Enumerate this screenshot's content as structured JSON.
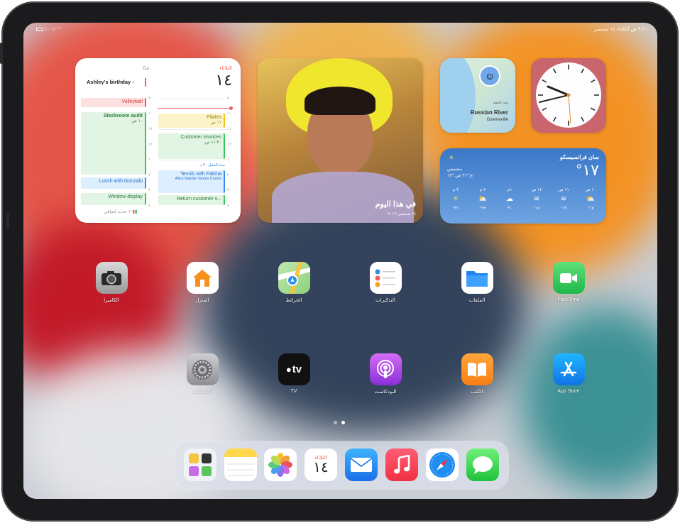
{
  "status_bar": {
    "time_date": "٩:٤١ ص الثلاثاء ١٤ سبتمبر",
    "battery": "١٠٠٪"
  },
  "calendar_widget": {
    "today_day": "الثلاثاء",
    "today_date": "١٤",
    "tomorrow_day": "غدًا",
    "all_day_event": "Ashley's birthday",
    "today_events": [
      {
        "title": "Volleyball"
      },
      {
        "title": "Stockroom audit",
        "time": "١٠ ص"
      },
      {
        "title": "Lunch with Gonzalo"
      },
      {
        "title": "Window display"
      }
    ],
    "more_events": "٢ حدث إضافي",
    "hours_left": [
      "٩",
      "١٠",
      "١١",
      "١٢",
      "١",
      "٢",
      "٣",
      "٤"
    ],
    "hours_right": [
      "٩",
      "١٠",
      "١١",
      "١٢",
      "١",
      "٢",
      "٣",
      "٤"
    ],
    "tomorrow_events": [
      {
        "title": "Pilates",
        "time": "١١ ص"
      },
      {
        "title": "Customer invoices",
        "time": "١١:٣٠ ص"
      },
      {
        "title": "Tennis with Fatima",
        "meta": "مدة التنقل ٣٠ د",
        "location": "Alice Marble Tennis Courts"
      },
      {
        "title": "Return customer s..."
      }
    ]
  },
  "photos_widget": {
    "title": "في هذا اليوم",
    "subtitle": "١٤ سبتمبر ٢٠١٦"
  },
  "maps_widget": {
    "minutes": "منذ دقيقة",
    "place": "Russian River",
    "area": "Guerneville"
  },
  "weather_widget": {
    "city": "سان فرانسيسكو",
    "temp": "°١٧",
    "condition": "مشمس",
    "range": "ع:°٢١ ص:°١٢",
    "hours": [
      {
        "time": "١٠ ص",
        "temp": "°١٧"
      },
      {
        "time": "١١ ص",
        "temp": "°١٩"
      },
      {
        "time": "١٢ ص",
        "temp": "°١٨"
      },
      {
        "time": "١م",
        "temp": "°٢٠"
      },
      {
        "time": "٢ م",
        "temp": "°٢٢"
      },
      {
        "time": "٣ م",
        "temp": "°٢١"
      }
    ]
  },
  "apps_row1": [
    {
      "label": "FaceTime",
      "icon": "facetime-icon"
    },
    {
      "label": "الملفات",
      "icon": "files-icon"
    },
    {
      "label": "التذكيرات",
      "icon": "reminders-icon"
    },
    {
      "label": "الخرائط",
      "icon": "maps-icon"
    },
    {
      "label": "المنزل",
      "icon": "home-icon"
    },
    {
      "label": "الكاميرا",
      "icon": "camera-icon"
    }
  ],
  "apps_row2": [
    {
      "label": "App Store",
      "icon": "app-store-icon"
    },
    {
      "label": "الكتب",
      "icon": "books-icon"
    },
    {
      "label": "البودكاست",
      "icon": "podcasts-icon"
    },
    {
      "label": "TV",
      "icon": "tv-icon"
    },
    {
      "label": "الإعدادات",
      "icon": "settings-icon"
    }
  ],
  "tv_glyph": "tv",
  "dock": {
    "calendar_day": "الثلاثاء",
    "calendar_date": "١٤"
  },
  "colors": {
    "calendar_red": "#f25c5c",
    "calendar_green": "#34c759",
    "calendar_blue": "#2f8fea",
    "weather_top": "#3a78c8",
    "weather_bottom": "#6fa4e2"
  }
}
